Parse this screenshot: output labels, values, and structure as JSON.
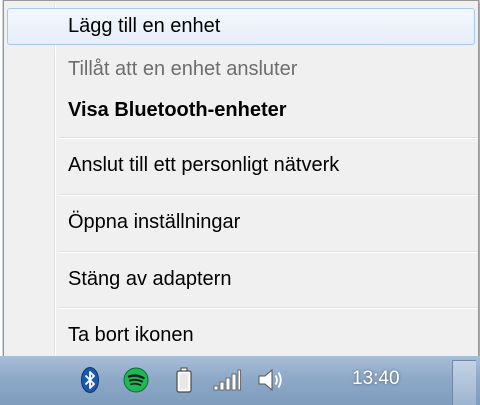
{
  "menu": {
    "items": [
      {
        "label": "Lägg till en enhet",
        "state": "highlighted"
      },
      {
        "label": "Tillåt att en enhet ansluter",
        "state": "disabled"
      },
      {
        "label": "Visa Bluetooth-enheter",
        "state": "default"
      },
      {
        "label": "Anslut till ett personligt nätverk",
        "state": "normal"
      },
      {
        "label": "Öppna inställningar",
        "state": "normal"
      },
      {
        "label": "Stäng av adaptern",
        "state": "normal"
      },
      {
        "label": "Ta bort ikonen",
        "state": "normal"
      }
    ]
  },
  "taskbar": {
    "tray_icons": [
      "bluetooth-icon",
      "spotify-icon",
      "battery-icon",
      "network-signal-icon",
      "volume-icon"
    ],
    "clock": "13:40"
  },
  "colors": {
    "menu_background": "#f0f0f0",
    "highlight_border": "#a8c6ee",
    "disabled_text": "#6d6d6d",
    "spotify_green": "#1db954",
    "bluetooth_blue": "#1b59a8"
  }
}
